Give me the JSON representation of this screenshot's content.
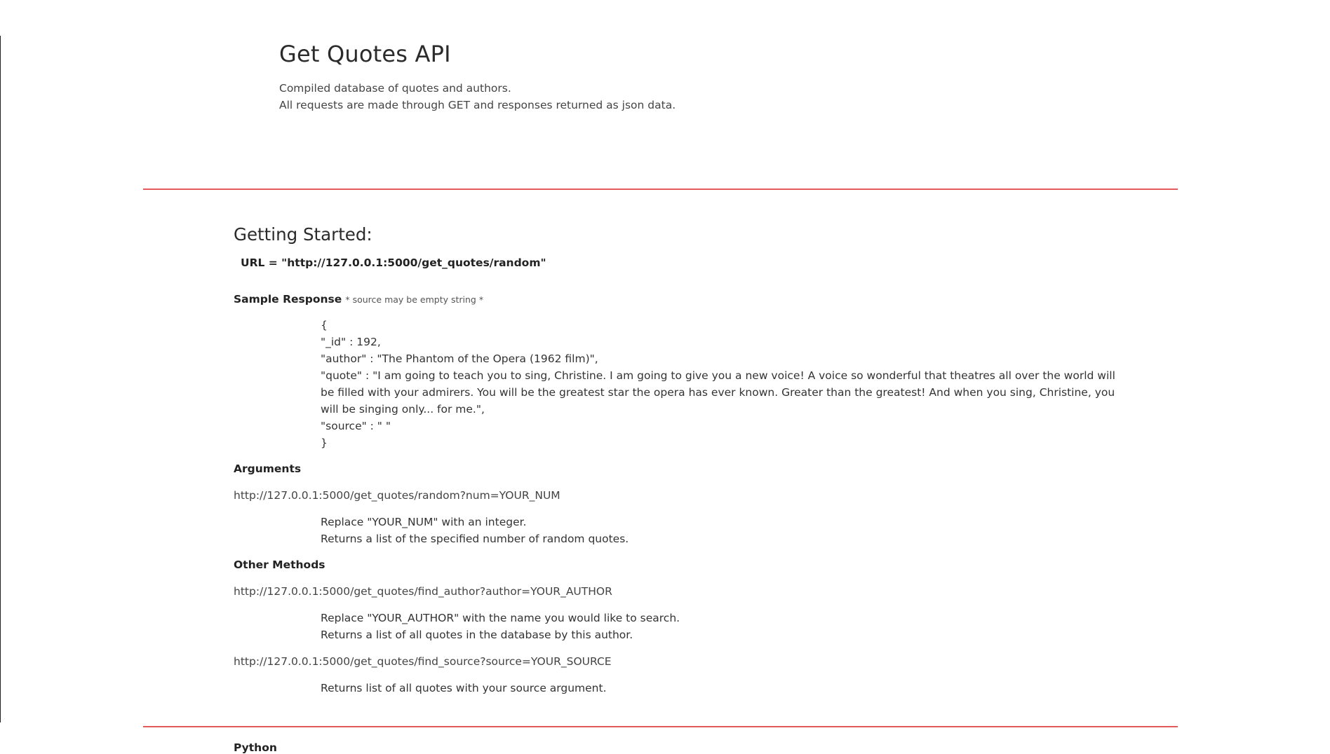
{
  "header": {
    "title": "Get Quotes API",
    "desc_line1": "Compiled database of quotes and authors.",
    "desc_line2": "All requests are made through GET and responses returned as json data."
  },
  "getting_started": {
    "heading": "Getting Started:",
    "url_line": "URL = \"http://127.0.0.1:5000/get_quotes/random\""
  },
  "sample_response": {
    "label": "Sample Response",
    "note": "* source may be empty string *",
    "json_open": "{",
    "json_id": "\"_id\" : 192,",
    "json_author": "\"author\" : \"The Phantom of the Opera (1962 film)\",",
    "json_quote": "\"quote\" : \"I am going to teach you to sing, Christine. I am going to give you a new voice! A voice so wonderful that theatres all over the world will be filled with your admirers. You will be the greatest star the opera has ever known. Greater than the greatest! And when you sing, Christine, you will be singing only... for me.\",",
    "json_source": "\"source\" : \" \"",
    "json_close": "}"
  },
  "arguments": {
    "label": "Arguments",
    "endpoint": "http://127.0.0.1:5000/get_quotes/random?num=YOUR_NUM",
    "line1": "Replace \"YOUR_NUM\" with an integer.",
    "line2": "Returns a list of the specified number of random quotes."
  },
  "other_methods": {
    "label": "Other Methods",
    "author_endpoint": "http://127.0.0.1:5000/get_quotes/find_author?author=YOUR_AUTHOR",
    "author_line1": "Replace \"YOUR_AUTHOR\" with the name you would like to search.",
    "author_line2": "Returns a list of all quotes in the database by this author.",
    "source_endpoint": "http://127.0.0.1:5000/get_quotes/find_source?source=YOUR_SOURCE",
    "source_line1": "Returns list of all quotes with your source argument."
  },
  "python": {
    "label": "Python"
  },
  "colors": {
    "rule": "#e45a5a",
    "text": "#333333",
    "background": "#ffffff"
  }
}
